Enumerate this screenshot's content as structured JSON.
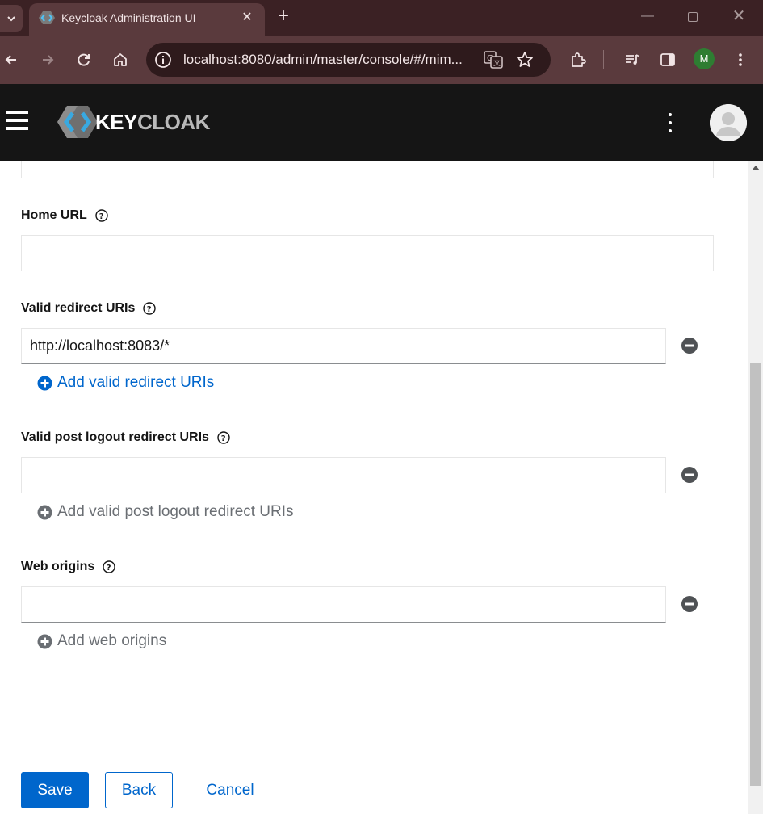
{
  "browser": {
    "tab_title": "Keycloak Administration UI",
    "tab_close": "✕",
    "new_tab": "+",
    "url": "localhost:8080/admin/master/console/#/mim...",
    "profile_initial": "M"
  },
  "header": {
    "logo_key": "KEY",
    "logo_cloak": "CLOAK"
  },
  "form": {
    "home_url": {
      "label": "Home URL",
      "value": ""
    },
    "valid_redirect": {
      "label": "Valid redirect URIs",
      "value": "http://localhost:8083/*",
      "add_label": "Add valid redirect URIs"
    },
    "post_logout": {
      "label": "Valid post logout redirect URIs",
      "value": "",
      "add_label": "Add valid post logout redirect URIs"
    },
    "web_origins": {
      "label": "Web origins",
      "value": "",
      "add_label": "Add web origins"
    }
  },
  "actions": {
    "save": "Save",
    "back": "Back",
    "cancel": "Cancel"
  },
  "colors": {
    "primary": "#0066cc",
    "header_bg": "#151515",
    "browser_frame": "#5a3a3d"
  }
}
